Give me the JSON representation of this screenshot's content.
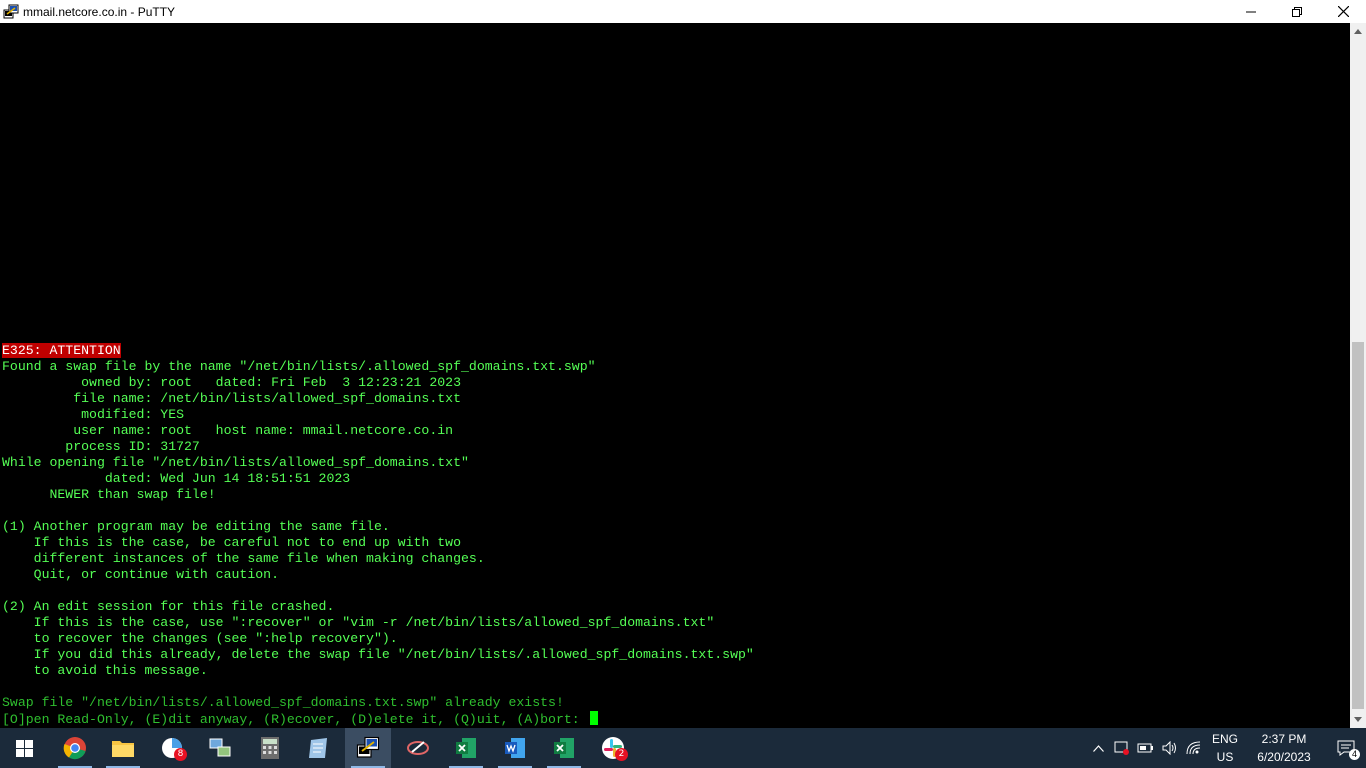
{
  "window": {
    "title": "mmail.netcore.co.in - PuTTY",
    "app_icon": "putty-icon",
    "controls": [
      "minimize-icon",
      "restore-icon",
      "close-icon"
    ]
  },
  "terminal": {
    "fg_color": "#55ff55",
    "bg_color": "#000000",
    "error_highlight_color": "#c00000",
    "lines": [
      "E325: ATTENTION",
      "Found a swap file by the name \"/net/bin/lists/.allowed_spf_domains.txt.swp\"",
      "          owned by: root   dated: Fri Feb  3 12:23:21 2023",
      "         file name: /net/bin/lists/allowed_spf_domains.txt",
      "          modified: YES",
      "         user name: root   host name: mmail.netcore.co.in",
      "        process ID: 31727",
      "While opening file \"/net/bin/lists/allowed_spf_domains.txt\"",
      "             dated: Wed Jun 14 18:51:51 2023",
      "      NEWER than swap file!",
      "",
      "(1) Another program may be editing the same file.",
      "    If this is the case, be careful not to end up with two",
      "    different instances of the same file when making changes.",
      "    Quit, or continue with caution.",
      "",
      "(2) An edit session for this file crashed.",
      "    If this is the case, use \":recover\" or \"vim -r /net/bin/lists/allowed_spf_domains.txt\"",
      "    to recover the changes (see \":help recovery\").",
      "    If you did this already, delete the swap file \"/net/bin/lists/.allowed_spf_domains.txt.swp\"",
      "    to avoid this message.",
      "",
      "Swap file \"/net/bin/lists/.allowed_spf_domains.txt.swp\" already exists!",
      "[O]pen Read-Only, (E)dit anyway, (R)ecover, (D)elete it, (Q)uit, (A)bort: "
    ]
  },
  "taskbar": {
    "apps": [
      {
        "name": "chrome-icon"
      },
      {
        "name": "file-explorer-icon"
      },
      {
        "name": "outlook-icon",
        "badge": "8"
      },
      {
        "name": "network-tool-icon"
      },
      {
        "name": "calculator-icon"
      },
      {
        "name": "notepad-icon"
      },
      {
        "name": "putty-icon",
        "active": true
      },
      {
        "name": "snipping-tool-icon"
      },
      {
        "name": "excel-icon"
      },
      {
        "name": "word-icon"
      },
      {
        "name": "excel-icon"
      },
      {
        "name": "slack-icon",
        "badge": "2"
      }
    ],
    "tray": {
      "lang_line1": "ENG",
      "lang_line2": "US",
      "time": "2:37 PM",
      "date": "6/20/2023",
      "notification_count": "4"
    }
  }
}
